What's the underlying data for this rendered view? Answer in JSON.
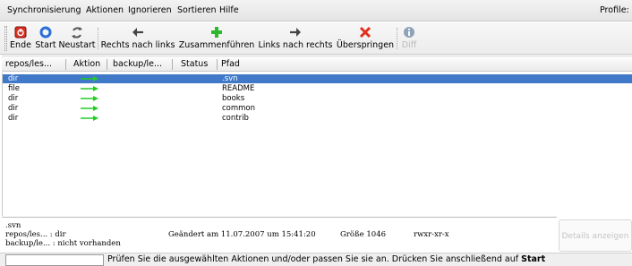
{
  "menu": {
    "items": [
      "Synchronisierung",
      "Aktionen",
      "Ignorieren",
      "Sortieren",
      "Hilfe"
    ],
    "profile_label": "Profile:"
  },
  "toolbar": {
    "buttons": [
      {
        "label": "Ende",
        "icon": "quit-icon"
      },
      {
        "label": "Start",
        "icon": "start-icon"
      },
      {
        "label": "Neustart",
        "icon": "restart-icon"
      },
      {
        "label": "Rechts nach links",
        "icon": "arrow-left-icon"
      },
      {
        "label": "Zusammenführen",
        "icon": "merge-icon"
      },
      {
        "label": "Links nach rechts",
        "icon": "arrow-right-icon"
      },
      {
        "label": "Überspringen",
        "icon": "skip-icon"
      },
      {
        "label": "Diff",
        "icon": "diff-icon",
        "disabled": true
      }
    ]
  },
  "columns": [
    "repos/les...",
    "Aktion",
    "backup/le...",
    "Status",
    "Pfad"
  ],
  "rows": [
    {
      "left": "dir",
      "action": "right-arrow",
      "right": "",
      "status": "",
      "path": ".svn",
      "selected": true
    },
    {
      "left": "file",
      "action": "right-arrow",
      "right": "",
      "status": "",
      "path": "README"
    },
    {
      "left": "dir",
      "action": "right-arrow",
      "right": "",
      "status": "",
      "path": "books"
    },
    {
      "left": "dir",
      "action": "right-arrow",
      "right": "",
      "status": "",
      "path": "common"
    },
    {
      "left": "dir",
      "action": "right-arrow",
      "right": "",
      "status": "",
      "path": "contrib"
    }
  ],
  "details": {
    "path": ".svn",
    "left_line": "repos/les... : dir",
    "right_line": "backup/le... : nicht vorhanden",
    "changed": "Geändert am 11.07.2007 um 15:41:20",
    "size": "Größe 1046",
    "perms": "rwxr-xr-x",
    "button_label": "Details anzeigen"
  },
  "status": {
    "input_value": "",
    "text": "Prüfen Sie die ausgewählten Aktionen und/oder passen Sie sie an. Drücken Sie anschließend auf",
    "bold": "Start"
  },
  "colors": {
    "selection": "#3f79c8",
    "action_arrow": "#22cc22"
  }
}
